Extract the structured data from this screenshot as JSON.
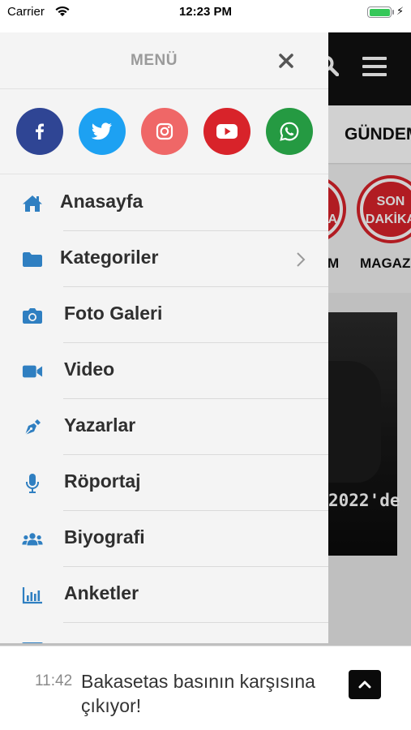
{
  "status_bar": {
    "carrier": "Carrier",
    "time": "12:23 PM",
    "battery_level": 1.0,
    "charging": true
  },
  "background": {
    "tab_label": "GÜNDEM",
    "stories": [
      {
        "circle_text": "SON DAKİKA",
        "label": "M"
      },
      {
        "circle_text": "SON DAKİKA",
        "label": "MAGAZİN"
      }
    ],
    "news_headline_fragment": "2022'de"
  },
  "drawer": {
    "title": "MENÜ",
    "social": [
      {
        "name": "facebook",
        "icon": "facebook-icon",
        "color": "#2f4594"
      },
      {
        "name": "twitter",
        "icon": "twitter-icon",
        "color": "#1da1f2"
      },
      {
        "name": "instagram",
        "icon": "instagram-icon",
        "color": "#ef6767"
      },
      {
        "name": "youtube",
        "icon": "youtube-icon",
        "color": "#d8232a"
      },
      {
        "name": "whatsapp",
        "icon": "whatsapp-icon",
        "color": "#259a42"
      }
    ],
    "menu": [
      {
        "label": "Anasayfa",
        "icon": "home-icon"
      },
      {
        "label": "Kategoriler",
        "icon": "folder-icon",
        "has_submenu": true
      },
      {
        "label": "Foto Galeri",
        "icon": "camera-icon"
      },
      {
        "label": "Video",
        "icon": "video-camera-icon"
      },
      {
        "label": "Yazarlar",
        "icon": "pen-icon"
      },
      {
        "label": "Röportaj",
        "icon": "microphone-icon"
      },
      {
        "label": "Biyografi",
        "icon": "users-icon"
      },
      {
        "label": "Anketler",
        "icon": "bar-chart-icon"
      }
    ],
    "accent_color": "#2f7fc1"
  },
  "ticker": {
    "time": "11:42",
    "headline": "Bakasetas basının karşısına çıkıyor!"
  }
}
